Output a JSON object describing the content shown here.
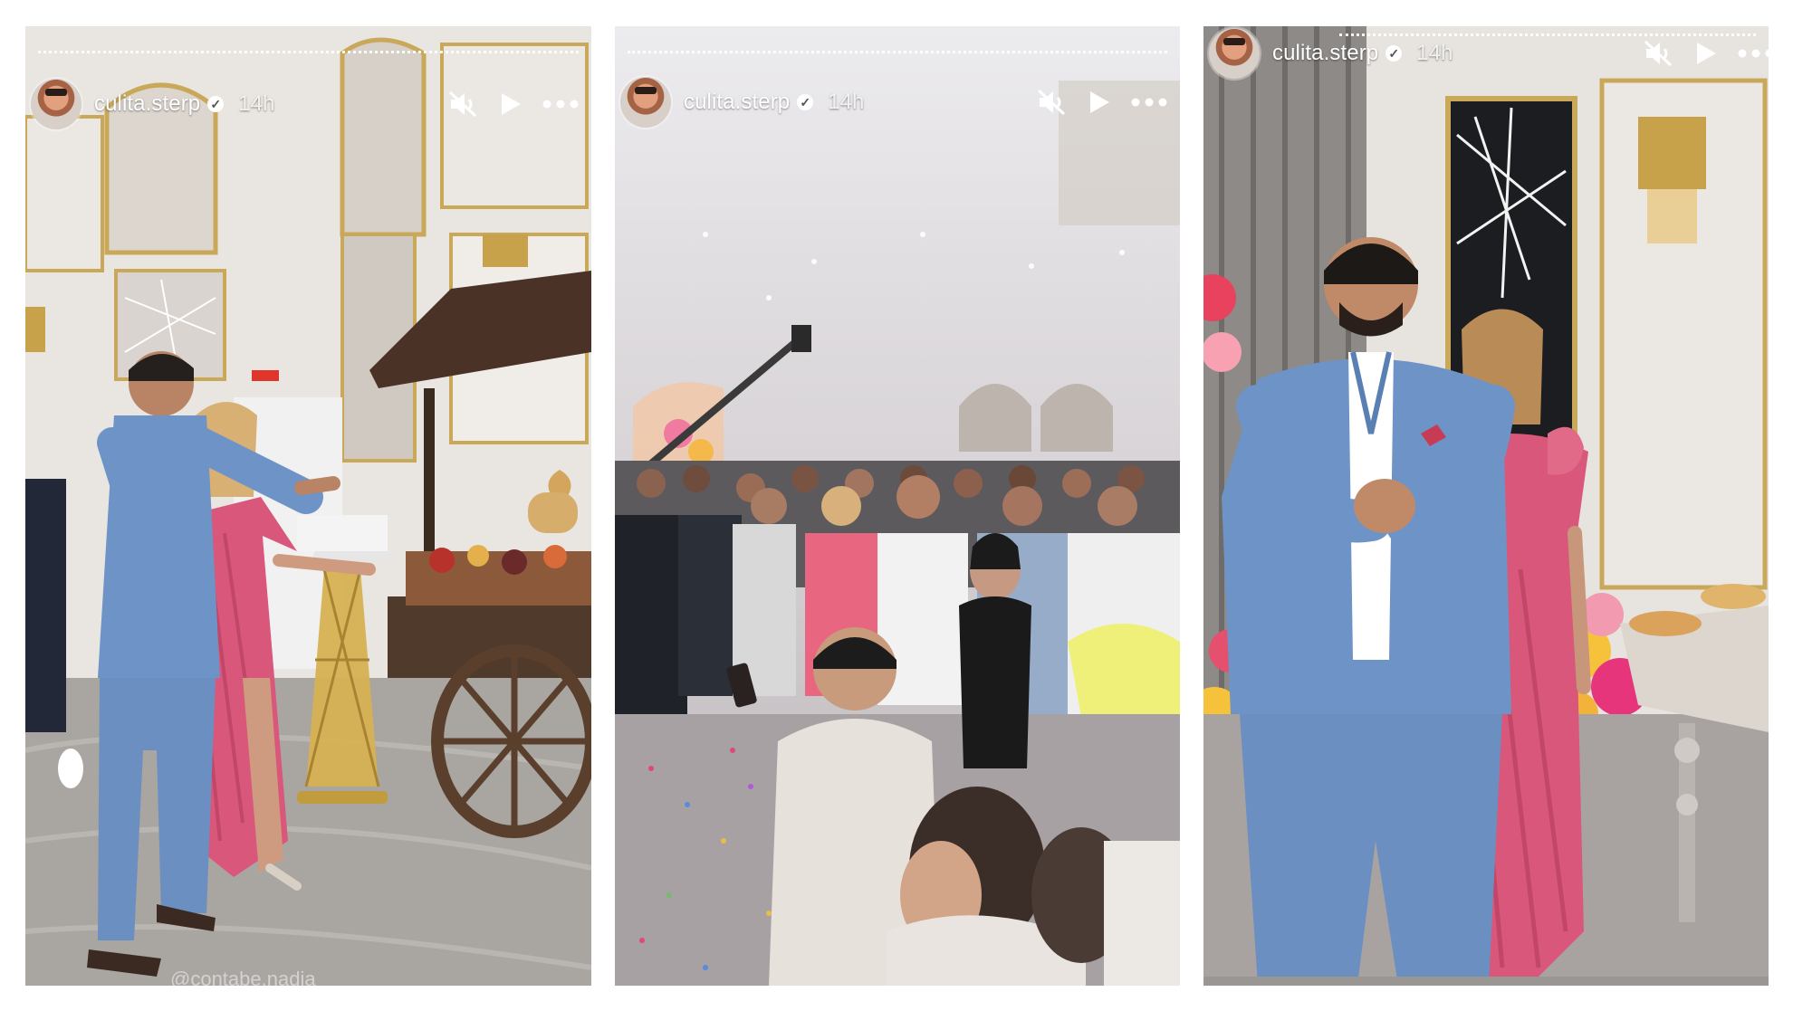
{
  "stories": [
    {
      "username": "culita.sterp",
      "time": "14h",
      "watermark": "@contabe.nadia"
    },
    {
      "username": "culita.sterp",
      "time": "14h"
    },
    {
      "username": "culita.sterp",
      "time": "14h"
    }
  ],
  "icons": {
    "verified": "verified-badge-icon",
    "mute": "speaker-muted-icon",
    "play": "play-icon",
    "more": "more-options-icon"
  },
  "colors": {
    "suit_blue": "#6e93c6",
    "dress_pink": "#d9577a",
    "wall": "#e6e1dc",
    "gold": "#c8a24a"
  }
}
